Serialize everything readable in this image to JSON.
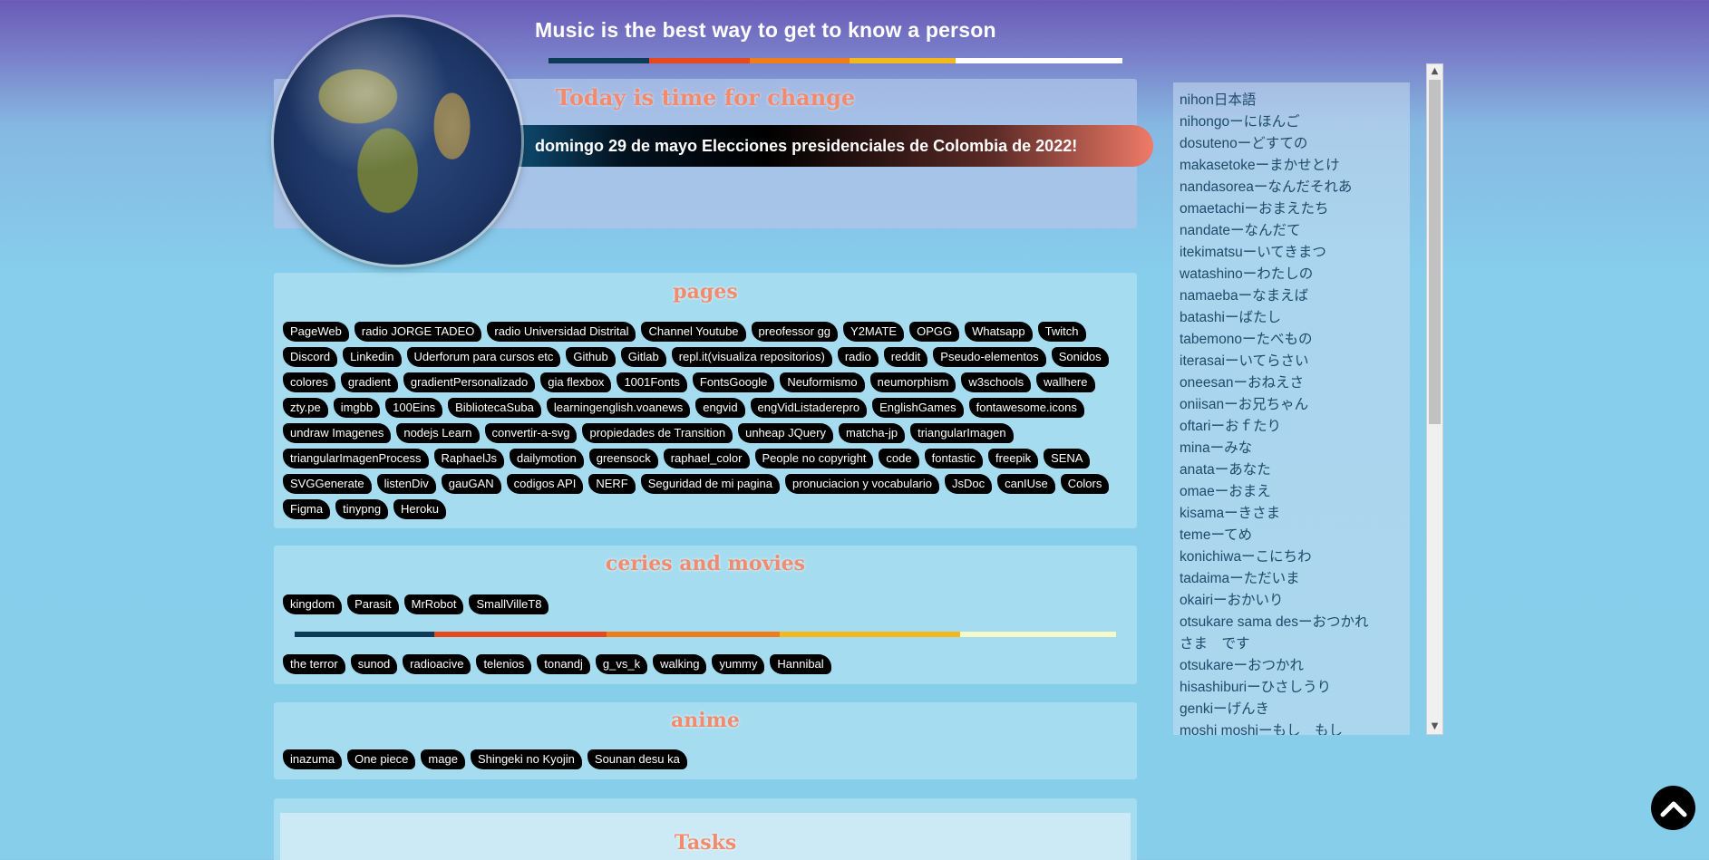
{
  "header": {
    "title": "Music is the best way to get to know a person"
  },
  "colors": {
    "stripe": [
      "#0d3b57",
      "#e8481e",
      "#f07d1a",
      "#f2b81c",
      "#ffffff"
    ],
    "stripe_series": [
      "#0d3b57",
      "#e8481e",
      "#f07d1a",
      "#f2b81c",
      "#f5f8c8"
    ],
    "heading": "#f28b6e",
    "tag_bg": "#000000"
  },
  "banner": {
    "title": "Today is time for change",
    "announcement": "domingo 29 de mayo Elecciones presidenciales de Colombia de 2022!"
  },
  "pages": {
    "title": "pages",
    "tags": [
      "PageWeb",
      "radio JORGE TADEO",
      "radio Universidad Distrital",
      "Channel Youtube",
      "preofessor gg",
      "Y2MATE",
      "OPGG",
      "Whatsapp",
      "Twitch",
      "Discord",
      "Linkedin",
      "Uderforum para cursos etc",
      "Github",
      "Gitlab",
      "repl.it(visualiza repositorios)",
      "radio",
      "reddit",
      "Pseudo-elementos",
      "Sonidos",
      "colores",
      "gradient",
      "gradientPersonalizado",
      "gia flexbox",
      "1001Fonts",
      "FontsGoogle",
      "Neuformismo",
      "neumorphism",
      "w3schools",
      "wallhere",
      "zty.pe",
      "imgbb",
      "100Eins",
      "BibliotecaSuba",
      "learningenglish.voanews",
      "engvid",
      "engVidListaderepro",
      "EnglishGames",
      "fontawesome.icons",
      "undraw Imagenes",
      "nodejs Learn",
      "convertir-a-svg",
      "propiedades de Transition",
      "unheap JQuery",
      "matcha-jp",
      "triangularImagen",
      "triangularImagenProcess",
      "RaphaelJs",
      "dailymotion",
      "greensock",
      "raphael_color",
      "People no copyright",
      "code",
      "fontastic",
      "freepik",
      "SENA",
      "SVGGenerate",
      "listenDiv",
      "gauGAN",
      "codigos API",
      "NERF",
      "Seguridad de mi pagina",
      "pronuciacion y vocabulario",
      "JsDoc",
      "canIUse",
      "Colors",
      "Figma",
      "tinypng",
      "Heroku"
    ]
  },
  "series": {
    "title": "ceries and movies",
    "row1": [
      "kingdom",
      "Parasit",
      "MrRobot",
      "SmallVilleT8"
    ],
    "row2": [
      "the terror",
      "sunod",
      "radioacive",
      "telenios",
      "tonandj",
      "g_vs_k",
      "walking",
      "yummy",
      "Hannibal"
    ]
  },
  "anime": {
    "title": "anime",
    "tags": [
      "inazuma",
      "One piece",
      "mage",
      "Shingeki no Kyojin",
      "Sounan desu ka"
    ]
  },
  "tasks": {
    "title": "Tasks"
  },
  "vocab": {
    "items": [
      "nihon日本語",
      "nihongoーにほんご",
      "dosutenoーどすての",
      "makasetokeーまかせとけ",
      "nandasoreaーなんだそれあ",
      "omaetachiーおまえたち",
      "nandateーなんだて",
      "itekimatsuーいてきまつ",
      "watashinoーわたしの",
      "namaebaーなまえば",
      "batashiーばたし",
      "tabemonoーたべもの",
      "iterasaiーいてらさい",
      "oneesanーおねえさ",
      "oniisanーお兄ちゃん",
      "oftariーおｆたり",
      "minaーみな",
      "anataーあなた",
      "omaeーおまえ",
      "kisamaーきさま",
      "temeーてめ",
      "konichiwaーこにちわ",
      "tadaimaーただいま",
      "okairiーおかいり",
      "otsukare sama desーおつかれ",
      "さま　です",
      "otsukareーおつかれ",
      "hisashiburiーひさしうり",
      "genkiーげんき",
      "moshi moshiーもし　もし"
    ]
  },
  "scroll": {
    "up_icon": "▲",
    "down_icon": "▼"
  }
}
